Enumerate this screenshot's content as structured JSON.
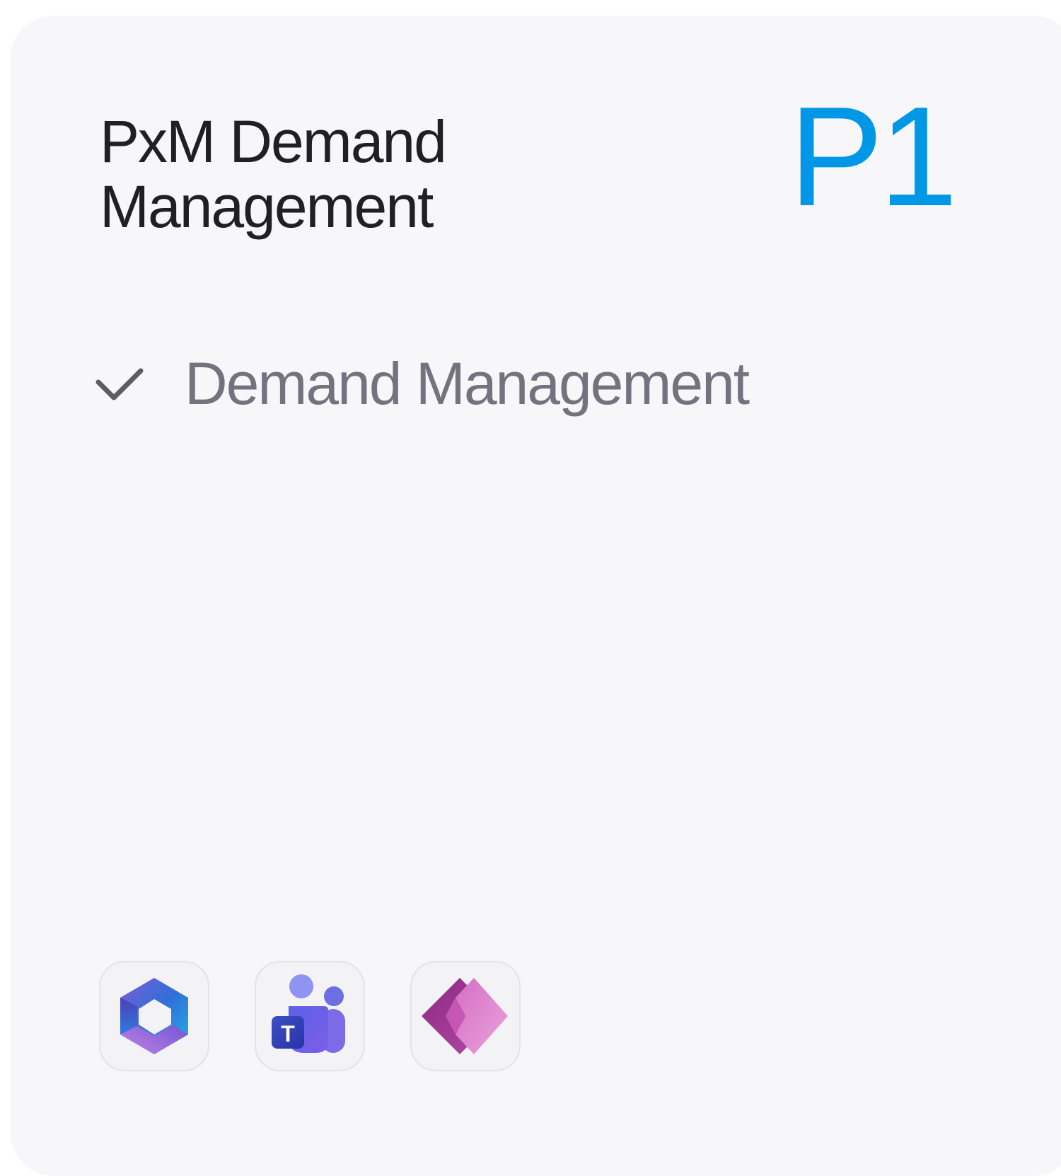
{
  "card": {
    "title": "PxM Demand Management",
    "plan": "P1",
    "accent_color": "#0098e6",
    "features": [
      {
        "label": "Demand Management",
        "icon": "check-icon"
      }
    ],
    "apps": [
      {
        "name": "microsoft-365",
        "icon": "microsoft-365-icon"
      },
      {
        "name": "microsoft-teams",
        "icon": "microsoft-teams-icon"
      },
      {
        "name": "power-apps",
        "icon": "power-apps-icon"
      }
    ]
  }
}
